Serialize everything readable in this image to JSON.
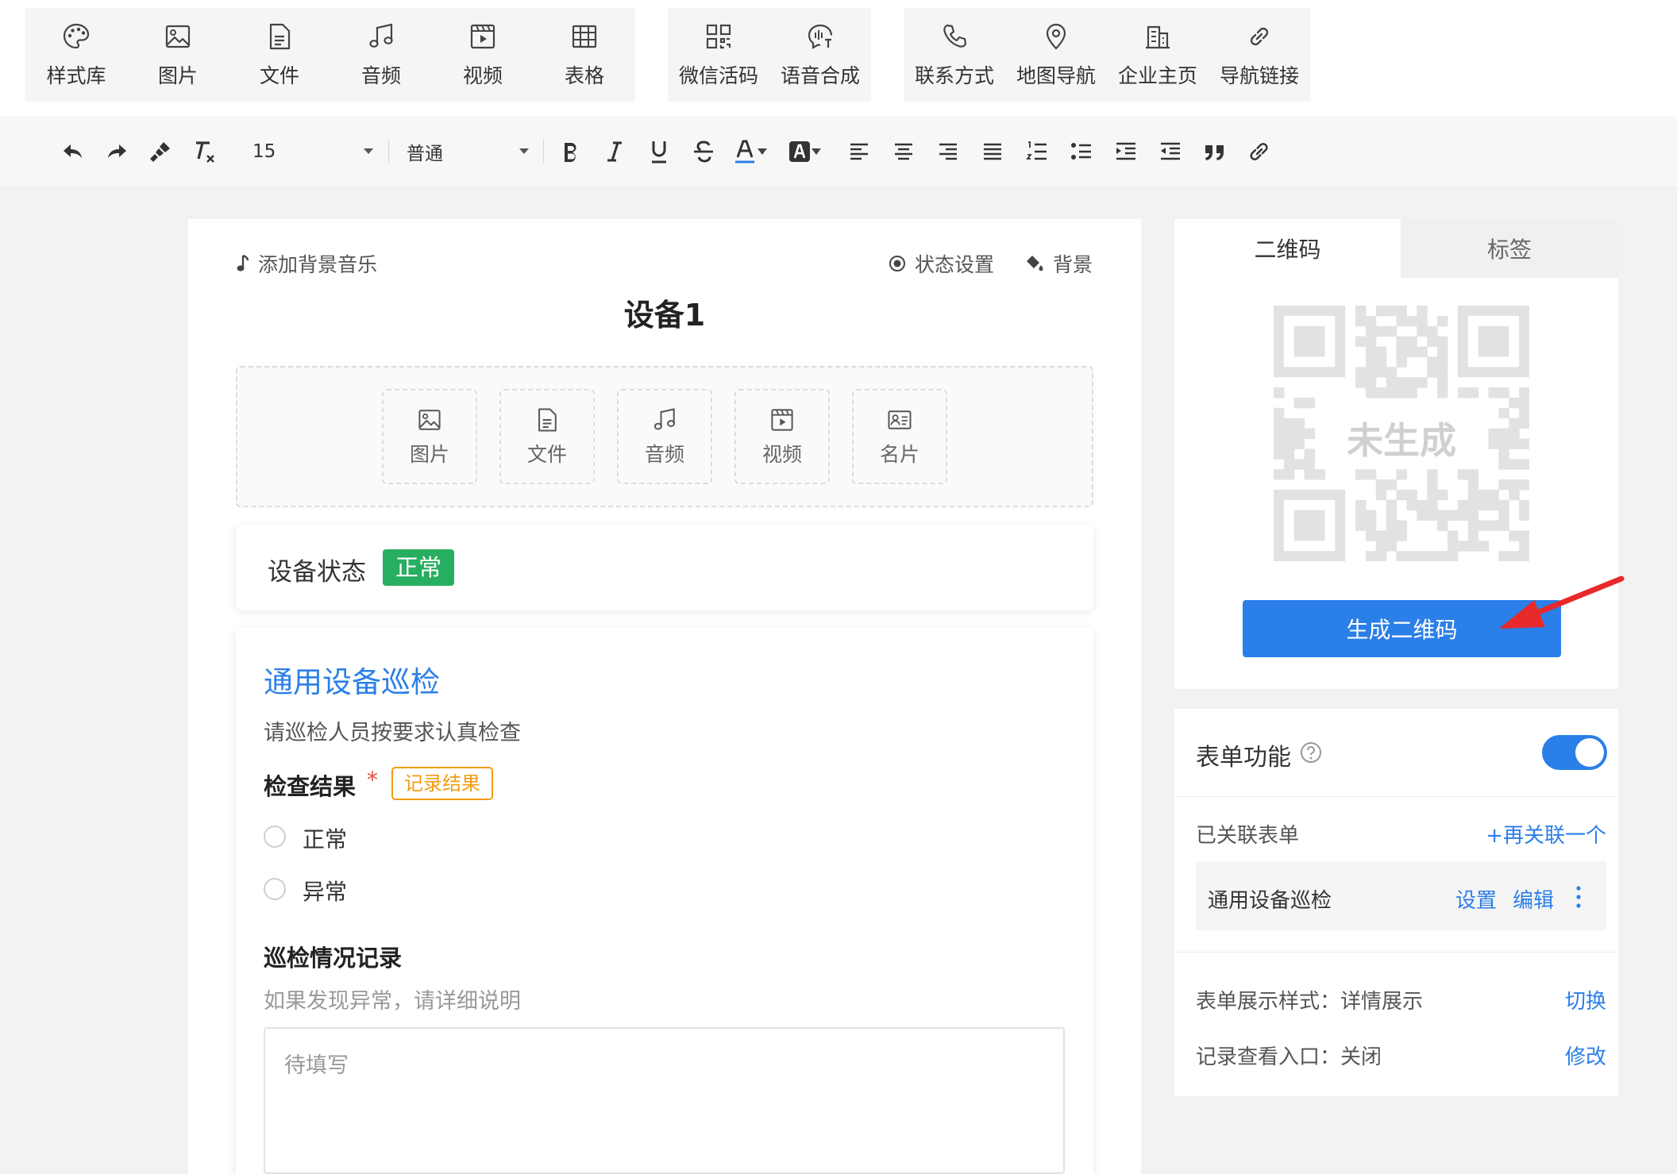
{
  "insert_toolbar": {
    "group1": [
      {
        "label": "样式库",
        "icon": "palette-icon"
      },
      {
        "label": "图片",
        "icon": "image-icon"
      },
      {
        "label": "文件",
        "icon": "file-icon"
      },
      {
        "label": "音频",
        "icon": "music-icon"
      },
      {
        "label": "视频",
        "icon": "video-icon"
      },
      {
        "label": "表格",
        "icon": "table-icon"
      }
    ],
    "group2": [
      {
        "label": "微信活码",
        "icon": "qrcode-icon"
      },
      {
        "label": "语音合成",
        "icon": "speech-icon"
      }
    ],
    "group3": [
      {
        "label": "联系方式",
        "icon": "phone-icon"
      },
      {
        "label": "地图导航",
        "icon": "map-pin-icon"
      },
      {
        "label": "企业主页",
        "icon": "building-icon"
      },
      {
        "label": "导航链接",
        "icon": "link-icon"
      }
    ]
  },
  "format_toolbar": {
    "font_size": "15",
    "paragraph_style": "普通",
    "buttons": [
      "undo",
      "redo",
      "format-painter",
      "clear-format",
      "bold",
      "italic",
      "underline",
      "strikethrough",
      "font-color",
      "background-color",
      "align-left",
      "align-center",
      "align-right",
      "justify",
      "ordered-list",
      "unordered-list",
      "indent",
      "outdent",
      "quote",
      "link"
    ]
  },
  "editor": {
    "bg_music": "添加背景音乐",
    "status_settings": "状态设置",
    "background": "背景",
    "title": "设备1",
    "attach_tiles": [
      {
        "label": "图片",
        "icon": "image-icon"
      },
      {
        "label": "文件",
        "icon": "file-icon"
      },
      {
        "label": "音频",
        "icon": "music-icon"
      },
      {
        "label": "视频",
        "icon": "video-icon"
      },
      {
        "label": "名片",
        "icon": "card-icon"
      }
    ],
    "status_label": "设备状态",
    "status_value": "正常",
    "status_color": "#27ae60",
    "form": {
      "title": "通用设备巡检",
      "description": "请巡检人员按要求认真检查",
      "q1_label": "检查结果",
      "q1_required": "*",
      "q1_tag": "记录结果",
      "q1_options": [
        "正常",
        "异常"
      ],
      "q2_label": "巡检情况记录",
      "q2_hint": "如果发现异常，请详细说明",
      "q2_placeholder": "待填写"
    }
  },
  "qr_panel": {
    "tabs": [
      "二维码",
      "标签"
    ],
    "active_tab": "二维码",
    "qr_placeholder": "未生成",
    "generate_button": "生成二维码",
    "accent": "#2b7fe8",
    "arrow_color": "#e8292b"
  },
  "form_panel": {
    "title": "表单功能",
    "toggle_on": true,
    "linked_label": "已关联表单",
    "link_more": "+再关联一个",
    "linked_form": "通用设备巡检",
    "settings": "设置",
    "edit": "编辑",
    "display_style_label": "表单展示样式：详情展示",
    "switch": "切换",
    "record_entry_label": "记录查看入口：关闭",
    "modify": "修改"
  }
}
